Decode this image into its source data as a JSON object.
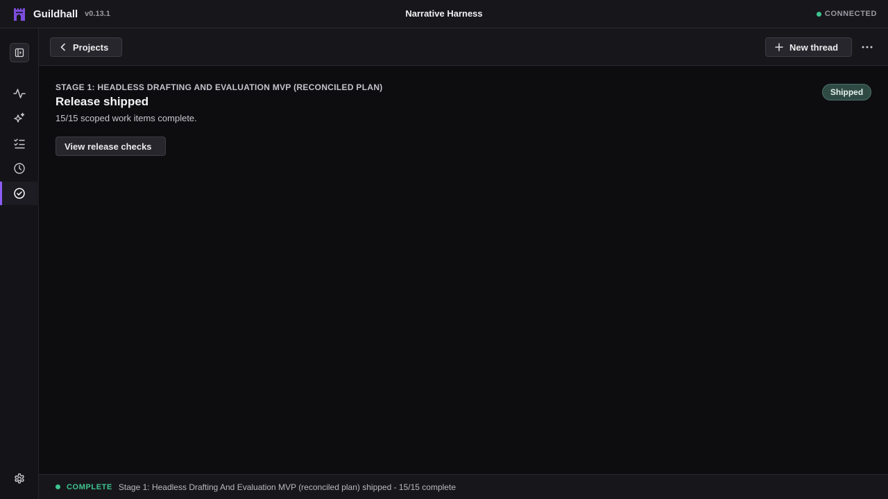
{
  "app": {
    "name": "Guildhall",
    "version": "v0.13.1",
    "window_title": "Narrative Harness",
    "connection_status": "CONNECTED",
    "accent_color": "#8b5cf6",
    "status_color": "#3ec48f"
  },
  "sidebar": {
    "toggle_icon": "sidebar-panel-icon",
    "items": [
      {
        "id": "activity",
        "icon": "activity-pulse-icon",
        "active": false
      },
      {
        "id": "sparkles",
        "icon": "sparkles-icon",
        "active": false
      },
      {
        "id": "tasks",
        "icon": "checklist-icon",
        "active": false
      },
      {
        "id": "history",
        "icon": "clock-icon",
        "active": false
      },
      {
        "id": "releases",
        "icon": "check-circle-icon",
        "active": true
      }
    ],
    "settings_icon": "gear-icon"
  },
  "toolbar": {
    "back_label": "Projects",
    "new_thread_label": "New thread",
    "more_icon": "ellipsis-icon"
  },
  "release": {
    "stage_label": "STAGE 1: HEADLESS DRAFTING AND EVALUATION MVP (RECONCILED PLAN)",
    "title": "Release shipped",
    "subtitle": "15/15 scoped work items complete.",
    "checks_button_label": "View release checks",
    "badge": "Shipped"
  },
  "statusbar": {
    "state": "COMPLETE",
    "message": "Stage 1: Headless Drafting And Evaluation MVP (reconciled plan) shipped - 15/15 complete"
  }
}
